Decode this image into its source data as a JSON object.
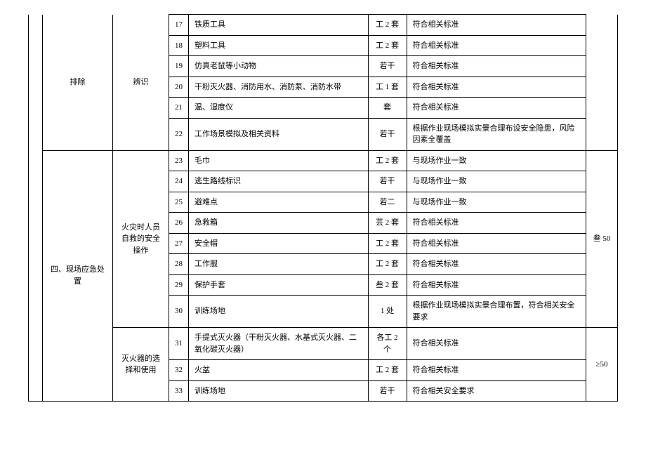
{
  "section1": {
    "colB": "排除",
    "colC": "辨识",
    "rows": [
      {
        "n": "17",
        "name": "铁质工具",
        "qty": "工 2 套",
        "req": "符合相关标准"
      },
      {
        "n": "18",
        "name": "塑料工具",
        "qty": "工 2 套",
        "req": "符合相关标准"
      },
      {
        "n": "19",
        "name": "仿真老鼠等小动物",
        "qty": "若干",
        "req": "符合相关标准"
      },
      {
        "n": "20",
        "name": "干粉灭火器、消防用水、消防泵、消防水带",
        "qty": "工 1 套",
        "req": "符合相关标准"
      },
      {
        "n": "21",
        "name": "温、湿度仪",
        "qty": "套",
        "req": "符合相关标准"
      },
      {
        "n": "22",
        "name": "工作场景模拟及相关资料",
        "qty": "若干",
        "req": "根据作业现场模拟实景合理布设安全隐患，风险因素全覆盖"
      }
    ]
  },
  "section2": {
    "colB": "四、现场应急处置",
    "group1": {
      "colC": "火灾时人员自救的安全操作",
      "colH": "叁 50",
      "rows": [
        {
          "n": "23",
          "name": "毛巾",
          "qty": "工 2 套",
          "req": "与现场作业一致"
        },
        {
          "n": "24",
          "name": "逃生路线标识",
          "qty": "若干",
          "req": "与现场作业一致"
        },
        {
          "n": "25",
          "name": "避难点",
          "qty": "若二",
          "req": "与现场作业一致"
        },
        {
          "n": "26",
          "name": "急救箱",
          "qty": "芸 2 套",
          "req": "符合相关标准"
        },
        {
          "n": "27",
          "name": "安全帽",
          "qty": "工 2 套",
          "req": "符合相关标准"
        },
        {
          "n": "28",
          "name": "工作服",
          "qty": "工 2 套",
          "req": "符合相关标准"
        },
        {
          "n": "29",
          "name": "保护手套",
          "qty": "叁 2 套",
          "req": "符合相关标准"
        },
        {
          "n": "30",
          "name": "训练场地",
          "qty": "1 处",
          "req": "根据作业现场模拟实景合理布置，符合相关安全要求"
        }
      ]
    },
    "group2": {
      "colC": "灭火器的选择和使用",
      "colH": "≥50",
      "rows": [
        {
          "n": "31",
          "name": "手提式灭火器（干粉灭火器、水基式灭火器、二氧化碳灭火器）",
          "qty": "各工 2 个",
          "req": "符合相关标准"
        },
        {
          "n": "32",
          "name": "火盆",
          "qty": "工 2 套",
          "req": "符合相关标准"
        },
        {
          "n": "33",
          "name": "训练场地",
          "qty": "若干",
          "req": "符合相关安全要求"
        }
      ]
    }
  }
}
